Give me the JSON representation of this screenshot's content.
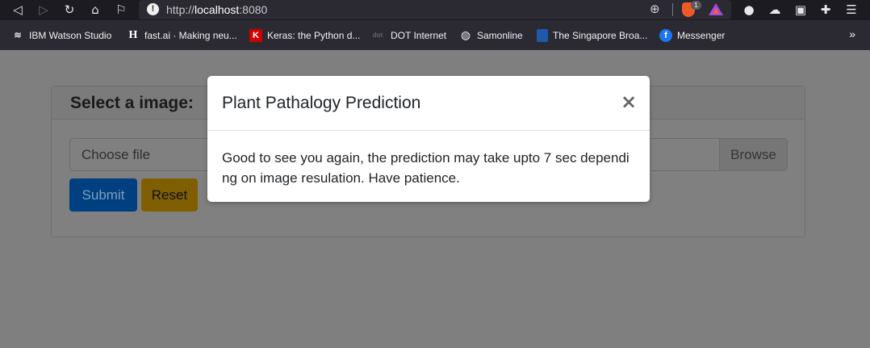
{
  "browser": {
    "url_scheme": "http://",
    "url_host": "localhost",
    "url_port": ":8080",
    "brave_badge": "1",
    "bookmarks": [
      {
        "label": "IBM Watson Studio",
        "icon": "ibm-icon"
      },
      {
        "label": "fast.ai · Making neu...",
        "icon": "fastai-icon"
      },
      {
        "label": "Keras: the Python d...",
        "icon": "keras-icon"
      },
      {
        "label": "DOT Internet",
        "icon": "dot-icon"
      },
      {
        "label": "Samonline",
        "icon": "globe-icon"
      },
      {
        "label": "The Singapore Broa...",
        "icon": "bookmark-page-icon"
      },
      {
        "label": "Messenger",
        "icon": "facebook-icon"
      }
    ],
    "more_label": "»"
  },
  "page": {
    "card_title": "Select a image:",
    "file_placeholder": "Choose file",
    "browse_label": "Browse",
    "submit_label": "Submit",
    "reset_label": "Reset"
  },
  "modal": {
    "title": "Plant Pathalogy Prediction",
    "close_symbol": "×",
    "body": "Good to see you again, the prediction may take upto 7 sec depending on image resulation. Have patience."
  }
}
